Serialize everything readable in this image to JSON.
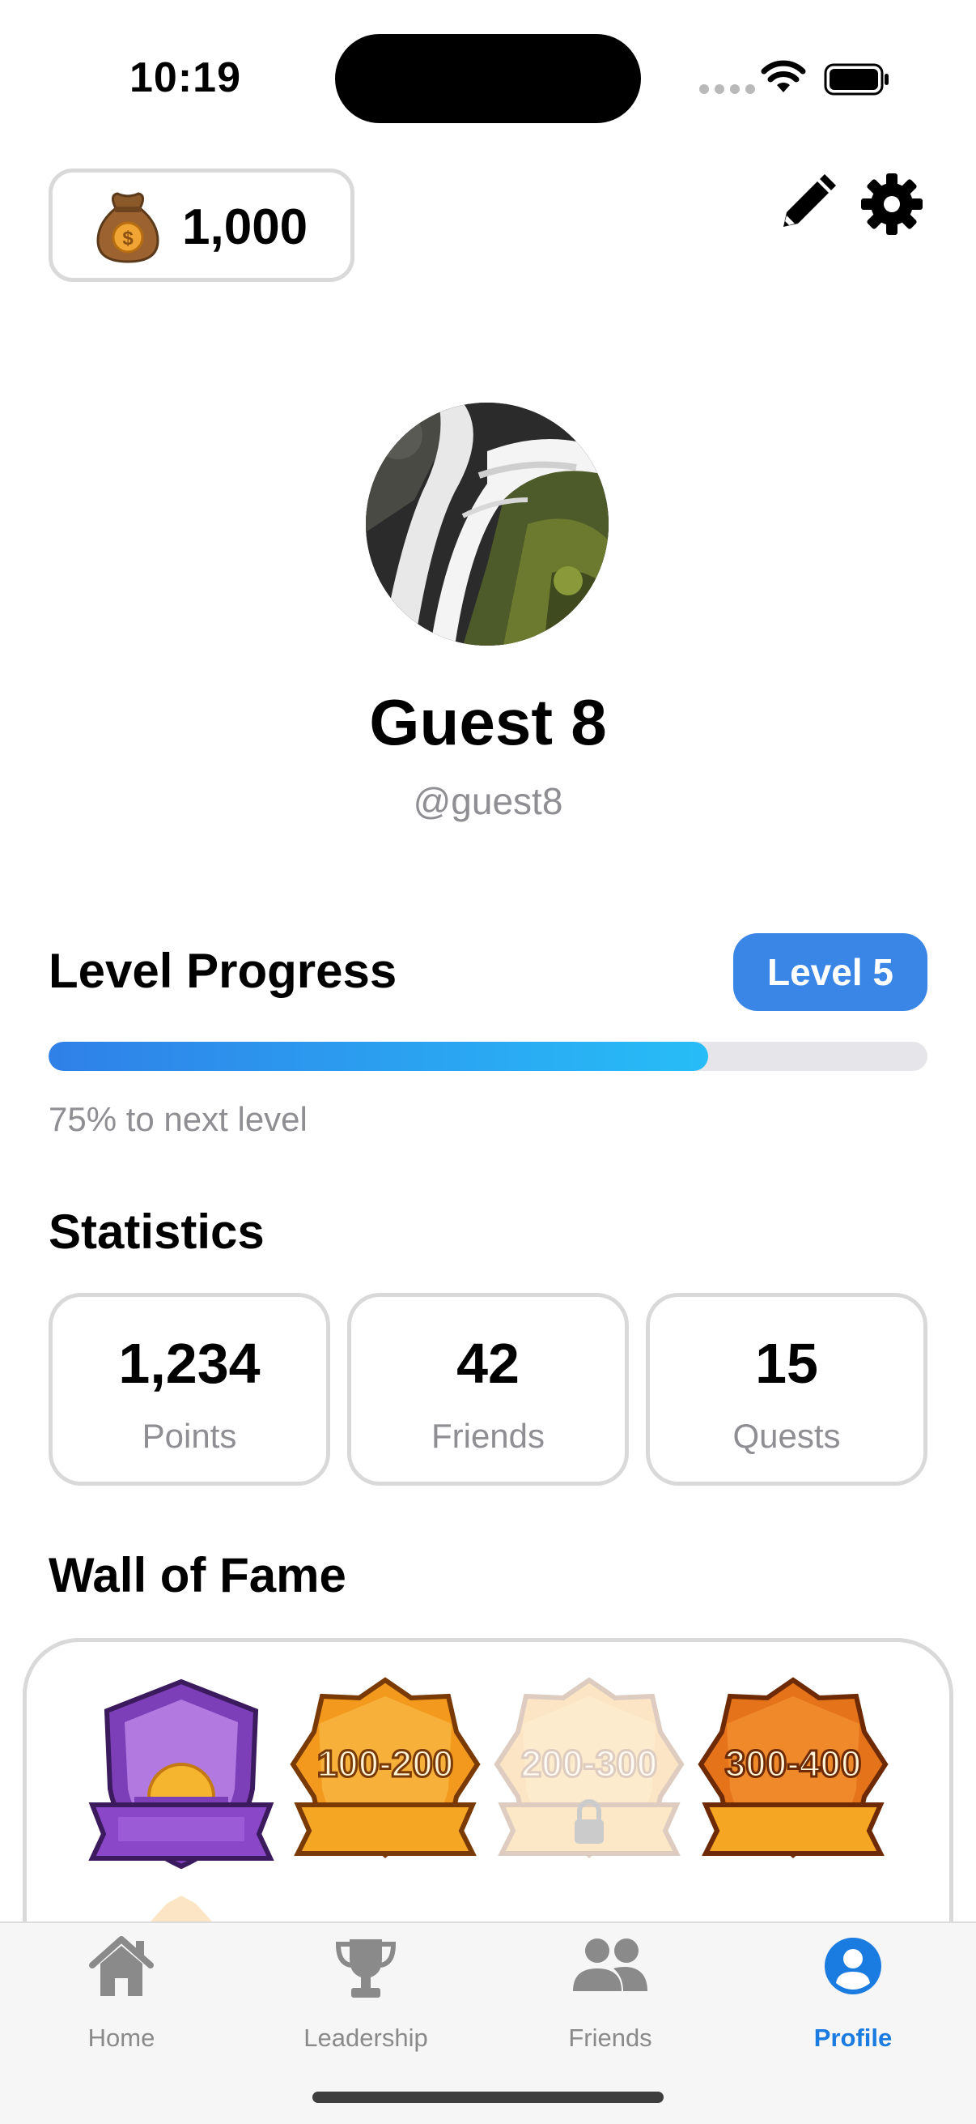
{
  "status_bar": {
    "time": "10:19"
  },
  "header": {
    "coins": "1,000",
    "coin_icon": "money-bag-icon",
    "edit_icon": "pencil-icon",
    "settings_icon": "gear-icon"
  },
  "profile": {
    "name": "Guest 8",
    "handle": "@guest8"
  },
  "level": {
    "title": "Level Progress",
    "badge": "Level 5",
    "progress_fraction": 0.75,
    "caption": "75% to next level",
    "colors": {
      "badge": "#3a86e6",
      "fill_start": "#2f80e8",
      "fill_end": "#27bdf7",
      "track": "#e6e6ea"
    }
  },
  "statistics": {
    "title": "Statistics",
    "items": [
      {
        "value": "1,234",
        "label": "Points"
      },
      {
        "value": "42",
        "label": "Friends"
      },
      {
        "value": "15",
        "label": "Quests"
      }
    ]
  },
  "wall_of_fame": {
    "title": "Wall of Fame",
    "badges": [
      {
        "icon": "sunset-shield-badge-icon",
        "label": "",
        "locked": false
      },
      {
        "icon": "range-badge-icon",
        "label": "100-200",
        "locked": false
      },
      {
        "icon": "range-badge-icon",
        "label": "200-300",
        "locked": true
      },
      {
        "icon": "range-badge-icon",
        "label": "300-400",
        "locked": false
      }
    ]
  },
  "tab_bar": {
    "items": [
      {
        "label": "Home",
        "icon": "house-icon",
        "active": false
      },
      {
        "label": "Leadership",
        "icon": "trophy-icon",
        "active": false
      },
      {
        "label": "Friends",
        "icon": "people-icon",
        "active": false
      },
      {
        "label": "Profile",
        "icon": "person-circle-icon",
        "active": true
      }
    ],
    "active_color": "#1a7be0"
  }
}
